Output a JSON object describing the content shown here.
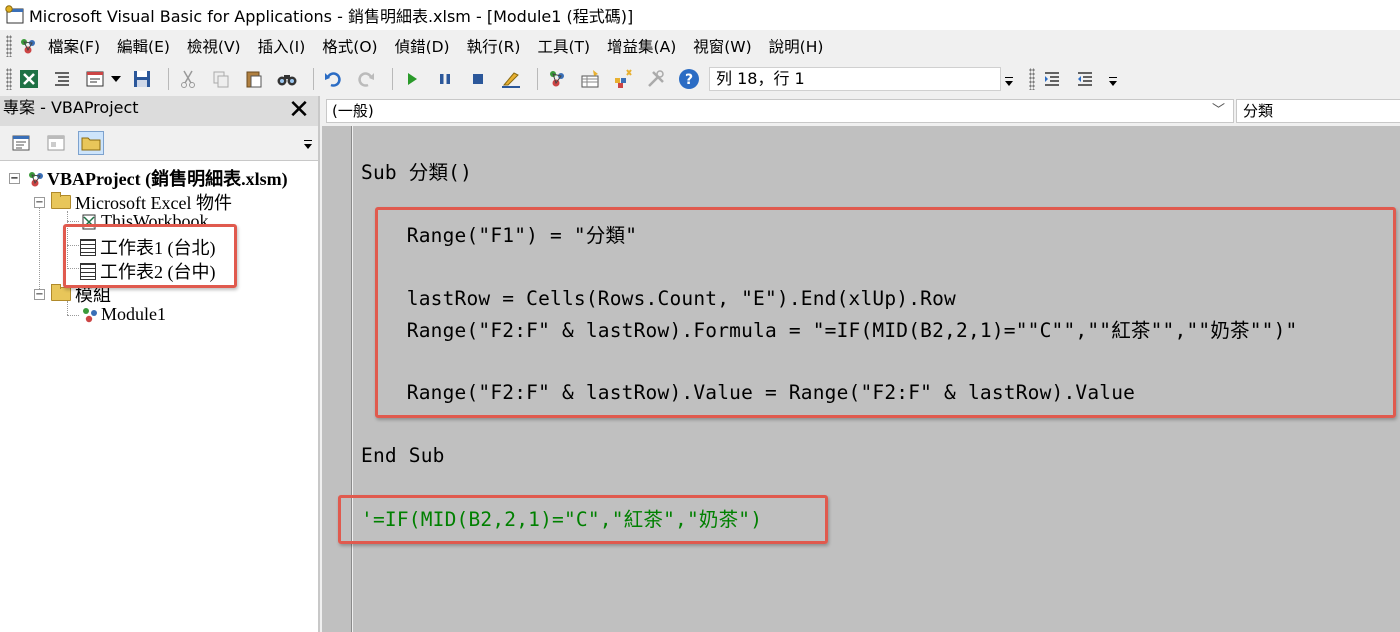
{
  "window": {
    "title": "Microsoft Visual Basic for Applications - 銷售明細表.xlsm - [Module1 (程式碼)]"
  },
  "menu": [
    "檔案(F)",
    "編輯(E)",
    "檢視(V)",
    "插入(I)",
    "格式(O)",
    "偵錯(D)",
    "執行(R)",
    "工具(T)",
    "增益集(A)",
    "視窗(W)",
    "說明(H)"
  ],
  "toolbar": {
    "position": "列 18，行 1"
  },
  "project": {
    "title": "專案 - VBAProject",
    "close": "✕",
    "tree": {
      "root": "VBAProject (銷售明細表.xlsm)",
      "excel_objects": "Microsoft Excel 物件",
      "this_workbook": "ThisWorkbook",
      "sheet1": "工作表1 (台北)",
      "sheet2": "工作表2 (台中)",
      "modules": "模組",
      "module1": "Module1"
    }
  },
  "code_window": {
    "object_combo": "(一般)",
    "proc_combo": "分類",
    "lines": [
      "Sub 分類()",
      "    Range(\"F1\") = \"分類\"",
      "    lastRow = Cells(Rows.Count, \"E\").End(xlUp).Row",
      "    Range(\"F2:F\" & lastRow).Formula = \"=IF(MID(B2,2,1)=\"\"C\"\",\"\"紅茶\"\",\"\"奶茶\"\")\"",
      "    Range(\"F2:F\" & lastRow).Value = Range(\"F2:F\" & lastRow).Value",
      "End Sub",
      "'=IF(MID(B2,2,1)=\"C\",\"紅茶\",\"奶茶\")"
    ]
  },
  "colors": {
    "highlight_box": "#e05a4e",
    "comment": "#008000",
    "code_background": "#c0c0c0"
  }
}
